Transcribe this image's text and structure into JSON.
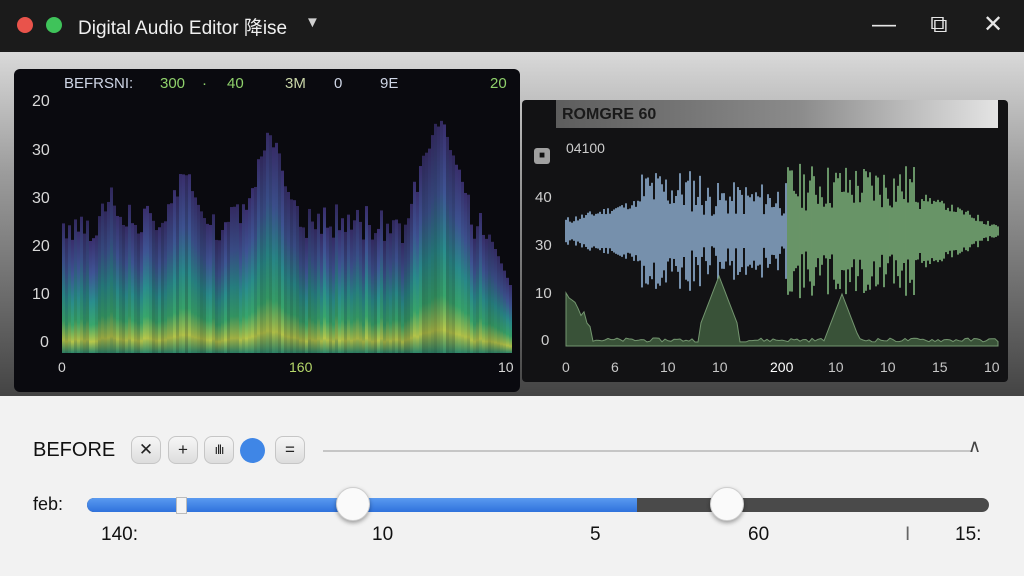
{
  "window": {
    "title": "Digital Audio Editor 降ise",
    "dropdown_icon": "chevron-down-icon",
    "controls": {
      "minimize": "—",
      "maximize": "⧉",
      "close": "✕"
    }
  },
  "spectrogram": {
    "header": {
      "label": "BEFRSNI:",
      "values": [
        "300",
        "·",
        "40",
        "3M",
        "0",
        "9E",
        "20"
      ]
    },
    "y_ticks": [
      "20",
      "30",
      "30",
      "20",
      "10",
      "0"
    ],
    "x_ticks": [
      "0",
      "160",
      "10"
    ],
    "colors": {
      "purple": "#4b3b8e",
      "teal": "#2a8f8f",
      "green": "#39a86d",
      "yellow": "#c7d34a",
      "orange": "#d08a3a"
    }
  },
  "waveform": {
    "title": "ROMGRE 60",
    "badge": "■",
    "subtitle": "04100",
    "y_ticks": [
      "40",
      "30",
      "10",
      "0"
    ],
    "x_ticks": [
      "0",
      "6",
      "10",
      "10",
      "200",
      "10",
      "10",
      "15",
      "10"
    ],
    "colors": {
      "blue": "#8fb0d2",
      "green": "#7fb57c",
      "spectrum": "#6f9a68"
    }
  },
  "controls": {
    "before_label": "BEFORE",
    "tools": [
      {
        "name": "cross-tool",
        "glyph": "✕"
      },
      {
        "name": "plus-tool",
        "glyph": "+"
      },
      {
        "name": "waveform-tool",
        "glyph": "ıllı"
      },
      {
        "name": "record-dot",
        "glyph": ""
      },
      {
        "name": "equals-tool",
        "glyph": "="
      }
    ],
    "thin_slider_marker": "∧",
    "feb_label": "feb:",
    "slider": {
      "fill_fraction": 0.61,
      "thumb1_fraction": 0.295,
      "thumb2_fraction": 0.71
    },
    "scale_labels": [
      "140:",
      "10",
      "5",
      "60",
      "I",
      "15:"
    ]
  }
}
